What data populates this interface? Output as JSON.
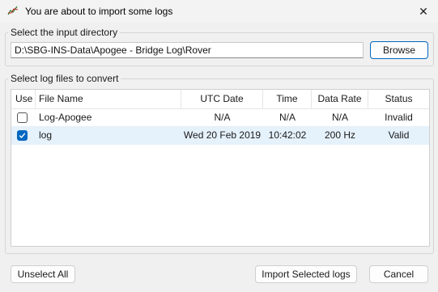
{
  "window": {
    "title": "You are about to import some logs",
    "icon": "chart-line-icon",
    "close_glyph": "✕"
  },
  "input_directory": {
    "legend": "Select the input directory",
    "path": "D:\\SBG-INS-Data\\Apogee - Bridge Log\\Rover",
    "browse_label": "Browse"
  },
  "log_files": {
    "legend": "Select log files to convert",
    "columns": [
      "Use",
      "File Name",
      "UTC Date",
      "Time",
      "Data Rate",
      "Status"
    ],
    "rows": [
      {
        "use": false,
        "file_name": "Log-Apogee",
        "utc_date": "N/A",
        "time": "N/A",
        "data_rate": "N/A",
        "status": "Invalid"
      },
      {
        "use": true,
        "file_name": "log",
        "utc_date": "Wed 20 Feb 2019",
        "time": "10:42:02",
        "data_rate": "200 Hz",
        "status": "Valid"
      }
    ]
  },
  "buttons": {
    "unselect_all": "Unselect All",
    "import_selected": "Import Selected logs",
    "cancel": "Cancel"
  },
  "colors": {
    "accent": "#0067c0",
    "selection": "#e5f1fb",
    "background": "#f0f0f0"
  }
}
